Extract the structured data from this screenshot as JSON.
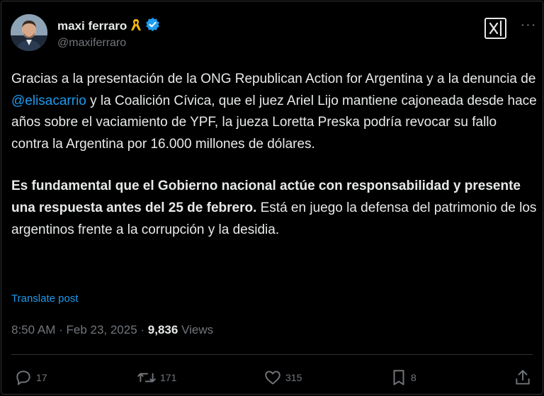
{
  "author": {
    "name": "maxi ferraro",
    "handle": "@maxiferraro"
  },
  "tweet": {
    "p1_a": "Gracias a la presentación de la ONG Republican Action for Argentina y a la denuncia de ",
    "mention": "@elisacarrio",
    "p1_b": " y la Coalición Cívica, que el juez Ariel Lijo mantiene cajoneada desde hace años sobre el vaciamiento de YPF, la jueza Loretta Preska podría revocar su fallo contra la Argentina por 16.000 millones de dólares.",
    "p2_bold": "Es fundamental que el Gobierno nacional actúe con responsabilidad y presente una respuesta antes del 25 de febrero.",
    "p2_rest": " Está en juego la defensa del patrimonio de los argentinos frente a la corrupción y la desidia."
  },
  "translate_label": "Translate post",
  "meta": {
    "time": "8:50 AM",
    "sep1": " · ",
    "date": "Feb 23, 2025",
    "sep2": " · ",
    "views_count": "9,836",
    "views_label": " Views"
  },
  "actions": {
    "replies": "17",
    "reposts": "171",
    "likes": "315",
    "bookmarks": "8"
  },
  "colors": {
    "background": "#000000",
    "text": "#e7e9ea",
    "secondary": "#71767b",
    "accent": "#1d9bf0",
    "verified": "#1d9bf0",
    "ribbon": "#f2b90c"
  },
  "icons": [
    "avatar",
    "yellow-ribbon-icon",
    "verified-badge-icon",
    "grok-icon",
    "more-icon",
    "reply-icon",
    "repost-icon",
    "like-icon",
    "bookmark-icon",
    "share-icon"
  ]
}
